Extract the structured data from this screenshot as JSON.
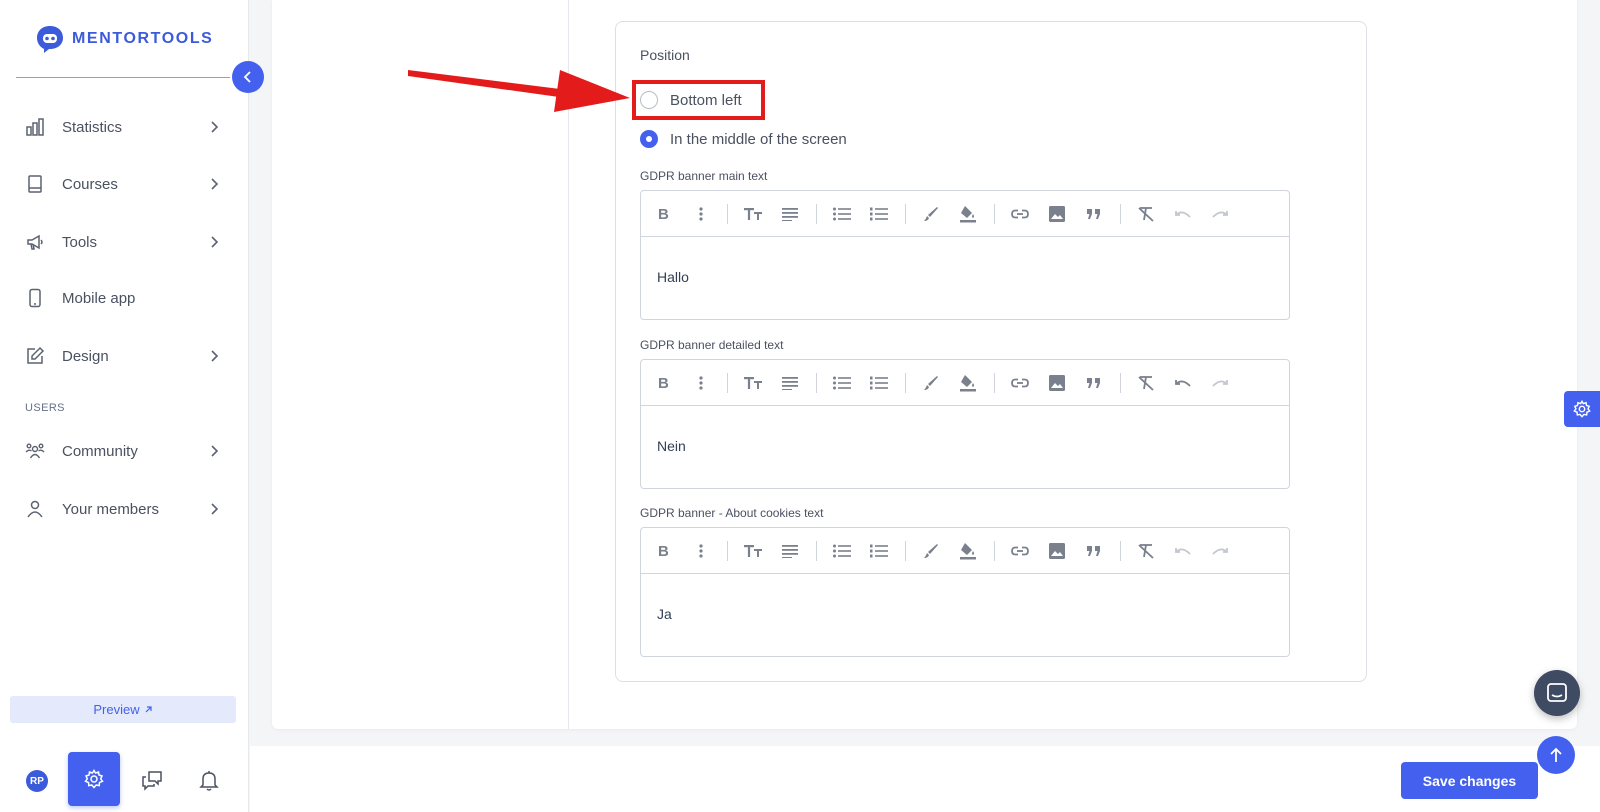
{
  "app": {
    "logo_text": "MENTORTOOLS"
  },
  "sidebar": {
    "items": [
      {
        "label": "Statistics",
        "icon": "bar-chart-icon",
        "has_chevron": true
      },
      {
        "label": "Courses",
        "icon": "book-icon",
        "has_chevron": true
      },
      {
        "label": "Tools",
        "icon": "megaphone-icon",
        "has_chevron": true
      },
      {
        "label": "Mobile app",
        "icon": "phone-icon",
        "has_chevron": false
      },
      {
        "label": "Design",
        "icon": "pencil-square-icon",
        "has_chevron": true
      },
      {
        "label": "Community",
        "icon": "people-icon",
        "has_chevron": true
      },
      {
        "label": "Your members",
        "icon": "user-icon",
        "has_chevron": true
      }
    ],
    "section_users": "USERS",
    "preview_label": "Preview",
    "avatar_initials": "RP"
  },
  "form": {
    "position_label": "Position",
    "options": [
      {
        "label": "Bottom left",
        "checked": false
      },
      {
        "label": "In the middle of the screen",
        "checked": true
      }
    ],
    "editors": [
      {
        "label": "GDPR banner main text",
        "content": "Hallo"
      },
      {
        "label": "GDPR banner detailed text",
        "content": "Nein"
      },
      {
        "label": "GDPR banner - About cookies text",
        "content": "Ja"
      }
    ]
  },
  "actions": {
    "save_label": "Save changes"
  },
  "colors": {
    "accent": "#4361ee",
    "highlight": "#e31b1b",
    "chat": "#3e4b63"
  }
}
